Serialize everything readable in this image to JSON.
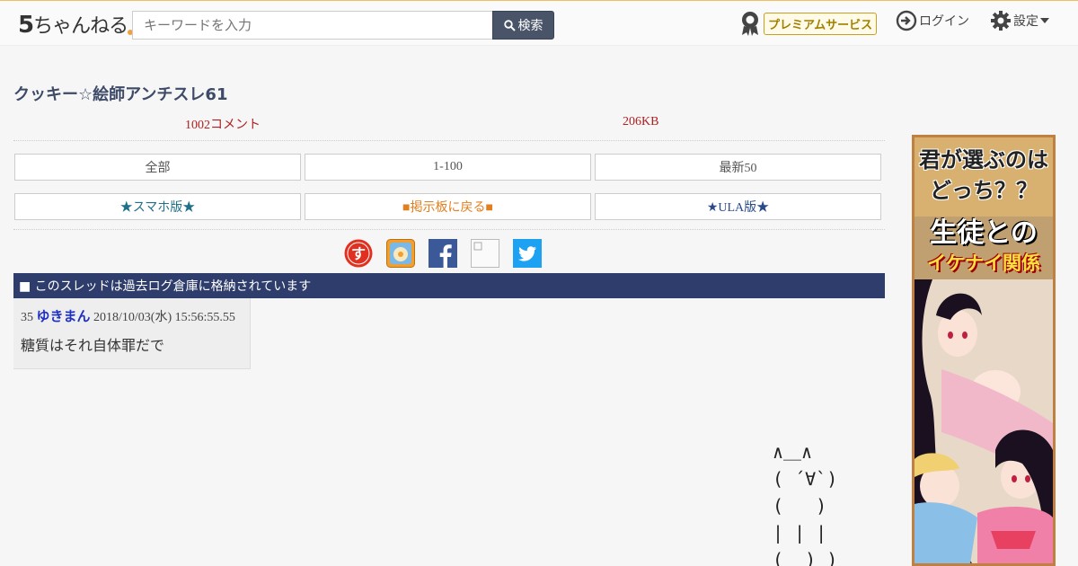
{
  "header": {
    "logo_main": "5",
    "logo_rest": "ちゃんねる",
    "search_placeholder": "キーワードを入力",
    "search_button": "検索",
    "premium_label": "プレミアムサービス",
    "login_label": "ログイン",
    "settings_label": "設定"
  },
  "thread": {
    "title": "クッキー☆絵師アンチスレ61",
    "comment_count": "1002コメント",
    "size": "206KB"
  },
  "nav_buttons": {
    "all": "全部",
    "range": "1-100",
    "latest": "最新50",
    "smartphone": "★スマホ版★",
    "back_to_board": "■掲示板に戻る■",
    "ula": "★ULA版★"
  },
  "social_icons": [
    "sumaho-icon",
    "matome-icon",
    "facebook-icon",
    "broken-image-icon",
    "twitter-icon"
  ],
  "archive_notice": "■ このスレッドは過去ログ倉庫に格納されています",
  "post": {
    "number": "35",
    "name": "ゆきまん",
    "date": "2018/10/03(水) 15:56:55.55",
    "body": "糖質はそれ自体罪だで"
  },
  "ascii_art": "∧＿∧\n( ´∀`)\n(   )\n| | |\n(__)_)",
  "ad": {
    "line1": "君が選ぶのは",
    "line2": "どっち？？",
    "line3": "生徒との",
    "line4": "イケナイ関係"
  },
  "colors": {
    "header_accent": "#f0c060",
    "title": "#3d4a68",
    "meta_red": "#b02020",
    "archive_bar": "#2e3d6b",
    "poster_name": "#2030c0"
  }
}
